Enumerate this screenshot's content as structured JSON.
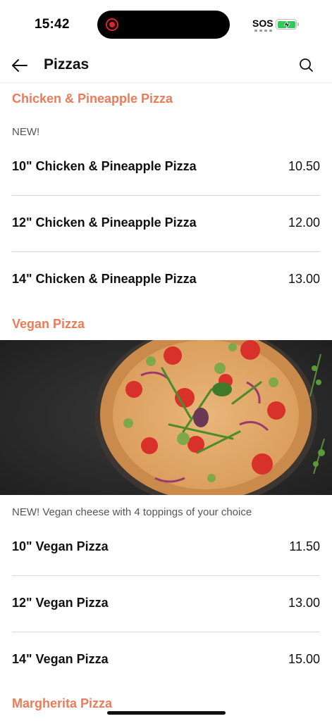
{
  "status_bar": {
    "time": "15:42",
    "sos": "SOS",
    "battery_color": "#34c759"
  },
  "header": {
    "title": "Pizzas",
    "back_icon": "arrow-left-icon",
    "search_icon": "search-icon"
  },
  "colors": {
    "accent": "#ed7b5a",
    "text": "#111111",
    "muted": "#555555"
  },
  "sections": [
    {
      "title": "Chicken & Pineapple Pizza",
      "description": "NEW!",
      "items": [
        {
          "name": "10\" Chicken & Pineapple Pizza",
          "price": "10.50"
        },
        {
          "name": "12\" Chicken & Pineapple Pizza",
          "price": "12.00"
        },
        {
          "name": "14\" Chicken & Pineapple Pizza",
          "price": "13.00"
        }
      ]
    },
    {
      "title": "Vegan Pizza",
      "description": "NEW! Vegan cheese with 4 toppings of your choice",
      "items": [
        {
          "name": "10\" Vegan Pizza",
          "price": "11.50"
        },
        {
          "name": "12\" Vegan Pizza",
          "price": "13.00"
        },
        {
          "name": "14\" Vegan Pizza",
          "price": "15.00"
        }
      ]
    },
    {
      "title": "Margherita Pizza"
    }
  ]
}
